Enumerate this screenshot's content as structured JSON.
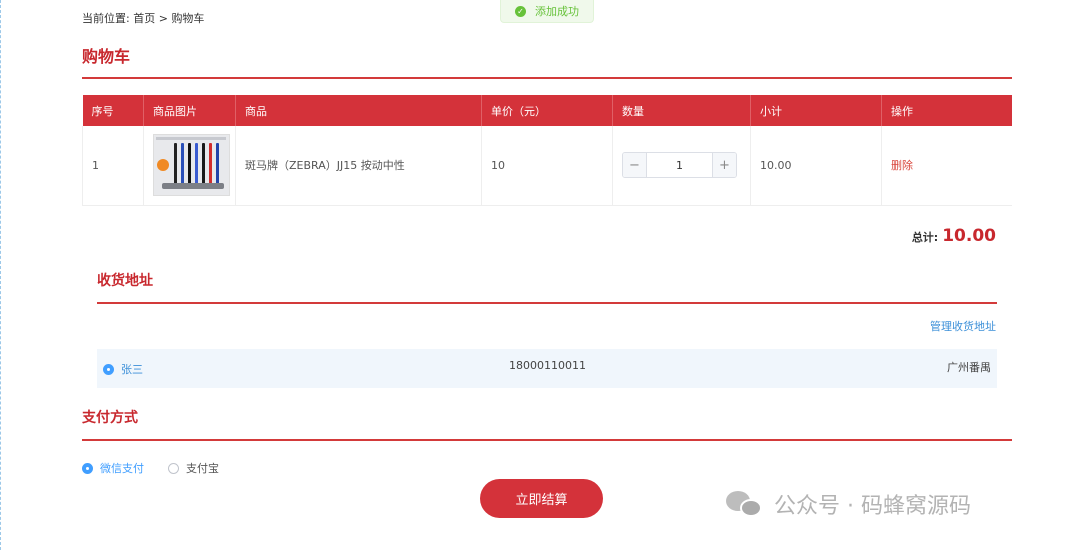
{
  "breadcrumb": {
    "prefix": "当前位置:",
    "home": "首页",
    "separator": ">",
    "current": "购物车"
  },
  "toast": {
    "message": "添加成功",
    "icon": "check-circle-icon",
    "color": "#67c23a"
  },
  "cart": {
    "title": "购物车",
    "columns": [
      "序号",
      "商品图片",
      "商品",
      "单价（元）",
      "数量",
      "小计",
      "操作"
    ],
    "rows": [
      {
        "index": "1",
        "product_name": "斑马牌（ZEBRA）JJ15 按动中性",
        "price": "10",
        "quantity": "1",
        "subtotal": "10.00",
        "action": "删除"
      }
    ],
    "stepper": {
      "minus": "−",
      "plus": "+"
    },
    "total_label": "总计:",
    "total_value": "10.00"
  },
  "address": {
    "title": "收货地址",
    "manage_link": "管理收货地址",
    "entries": [
      {
        "name": "张三",
        "phone": "18000110011",
        "city": "广州番禺",
        "selected": true
      }
    ]
  },
  "payment": {
    "title": "支付方式",
    "options": [
      {
        "label": "微信支付",
        "selected": true
      },
      {
        "label": "支付宝",
        "selected": false
      }
    ]
  },
  "checkout_button": "立即结算",
  "watermark": "公众号 · 码蜂窝源码",
  "colors": {
    "accent": "#d4323a",
    "link": "#409eff",
    "success": "#67c23a"
  }
}
